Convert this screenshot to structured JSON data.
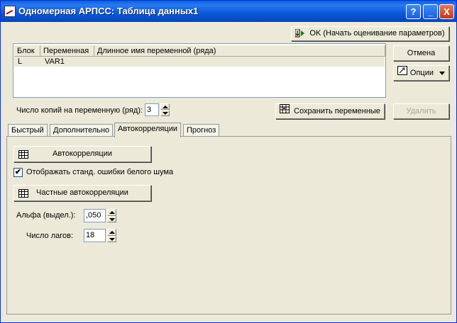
{
  "window": {
    "title": "Одномерная АРПСС: Таблица данных1",
    "help": "?",
    "minimize": "_",
    "close": "X"
  },
  "buttons": {
    "ok": "OK (Начать оценивание параметров)",
    "cancel": "Отмена",
    "options": "Опции",
    "save_vars": "Сохранить переменные",
    "delete": "Удалить"
  },
  "list": {
    "headers": [
      "Блок",
      "Переменная",
      "Длинное имя переменной (ряда)"
    ],
    "rows": [
      {
        "block": "L",
        "variable": "VAR1",
        "long_name": ""
      }
    ]
  },
  "copies": {
    "label": "Число копий на переменную (ряд):",
    "value": "3"
  },
  "tabs": [
    "Быстрый",
    "Дополнительно",
    "Автокорреляции",
    "Прогноз"
  ],
  "active_tab": "Автокорреляции",
  "autocorr": {
    "autocorr_button": "Автокорреляции",
    "white_noise_check_label": "Отображать станд. ошибки белого шума",
    "white_noise_checked": true,
    "check_mark": "✔",
    "partial_button": "Частные автокорреляции",
    "alpha_label": "Альфа (выдел.):",
    "alpha_value": ",050",
    "lags_label": "Число лагов:",
    "lags_value": "18"
  }
}
